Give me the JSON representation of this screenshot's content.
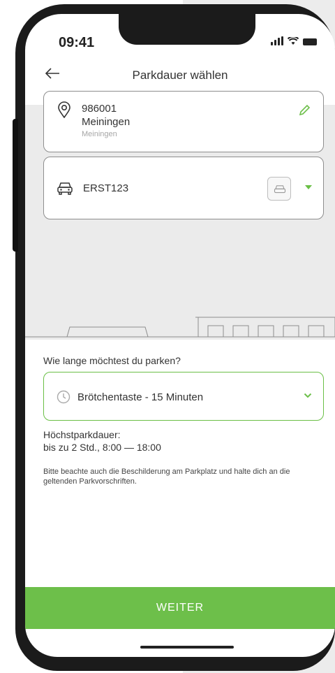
{
  "status_bar": {
    "time": "09:41"
  },
  "header": {
    "title": "Parkdauer wählen",
    "back_icon": "arrow-left-icon"
  },
  "location": {
    "id": "986001",
    "name": "Meiningen",
    "subtitle": "Meiningen",
    "edit_icon": "pencil-icon"
  },
  "vehicle": {
    "plate": "ERST123",
    "icon": "car-icon"
  },
  "duration": {
    "question": "Wie lange möchtest du parken?",
    "selected": "Brötchentaste - 15 Minuten"
  },
  "max_parking": {
    "label": "Höchstparkdauer:",
    "value": "bis zu 2 Std., 8:00 — 18:00"
  },
  "note": "Bitte beachte auch die Beschilderung am Parkplatz und halte dich an die geltenden Parkvorschriften.",
  "cta": {
    "label": "WEITER"
  },
  "colors": {
    "accent": "#6dbf4a",
    "border": "#8e8e8e"
  }
}
